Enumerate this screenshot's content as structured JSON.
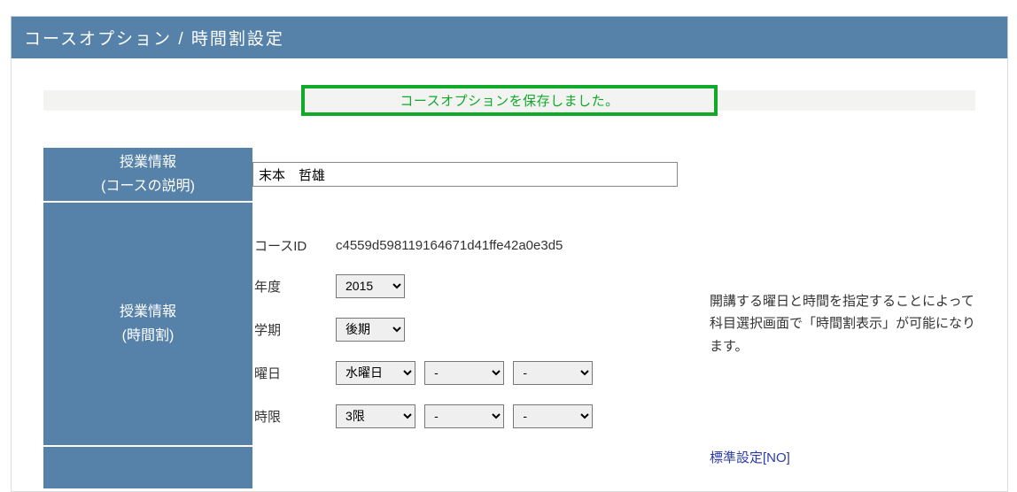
{
  "page_title": "コースオプション / 時間割設定",
  "notice": "コースオプションを保存しました。",
  "sections": {
    "class_info_desc": {
      "line1": "授業情報",
      "line2": "(コースの説明)"
    },
    "class_info_tt": {
      "line1": "授業情報",
      "line2": "(時間割)"
    }
  },
  "teacher_name": "末本　哲雄",
  "labels": {
    "course_id": "コースID",
    "year": "年度",
    "term": "学期",
    "day": "曜日",
    "period": "時限"
  },
  "course_id": "c4559d598119164671d41ffe42a0e3d5",
  "selects": {
    "year": "2015",
    "term": "後期",
    "day1": "水曜日",
    "day2": "-",
    "day3": "-",
    "per1": "3限",
    "per2": "-",
    "per3": "-"
  },
  "help_text": "開講する曜日と時間を指定することによって科目選択画面で「時間割表示」が可能になります。",
  "std_link": "標準設定[NO]"
}
